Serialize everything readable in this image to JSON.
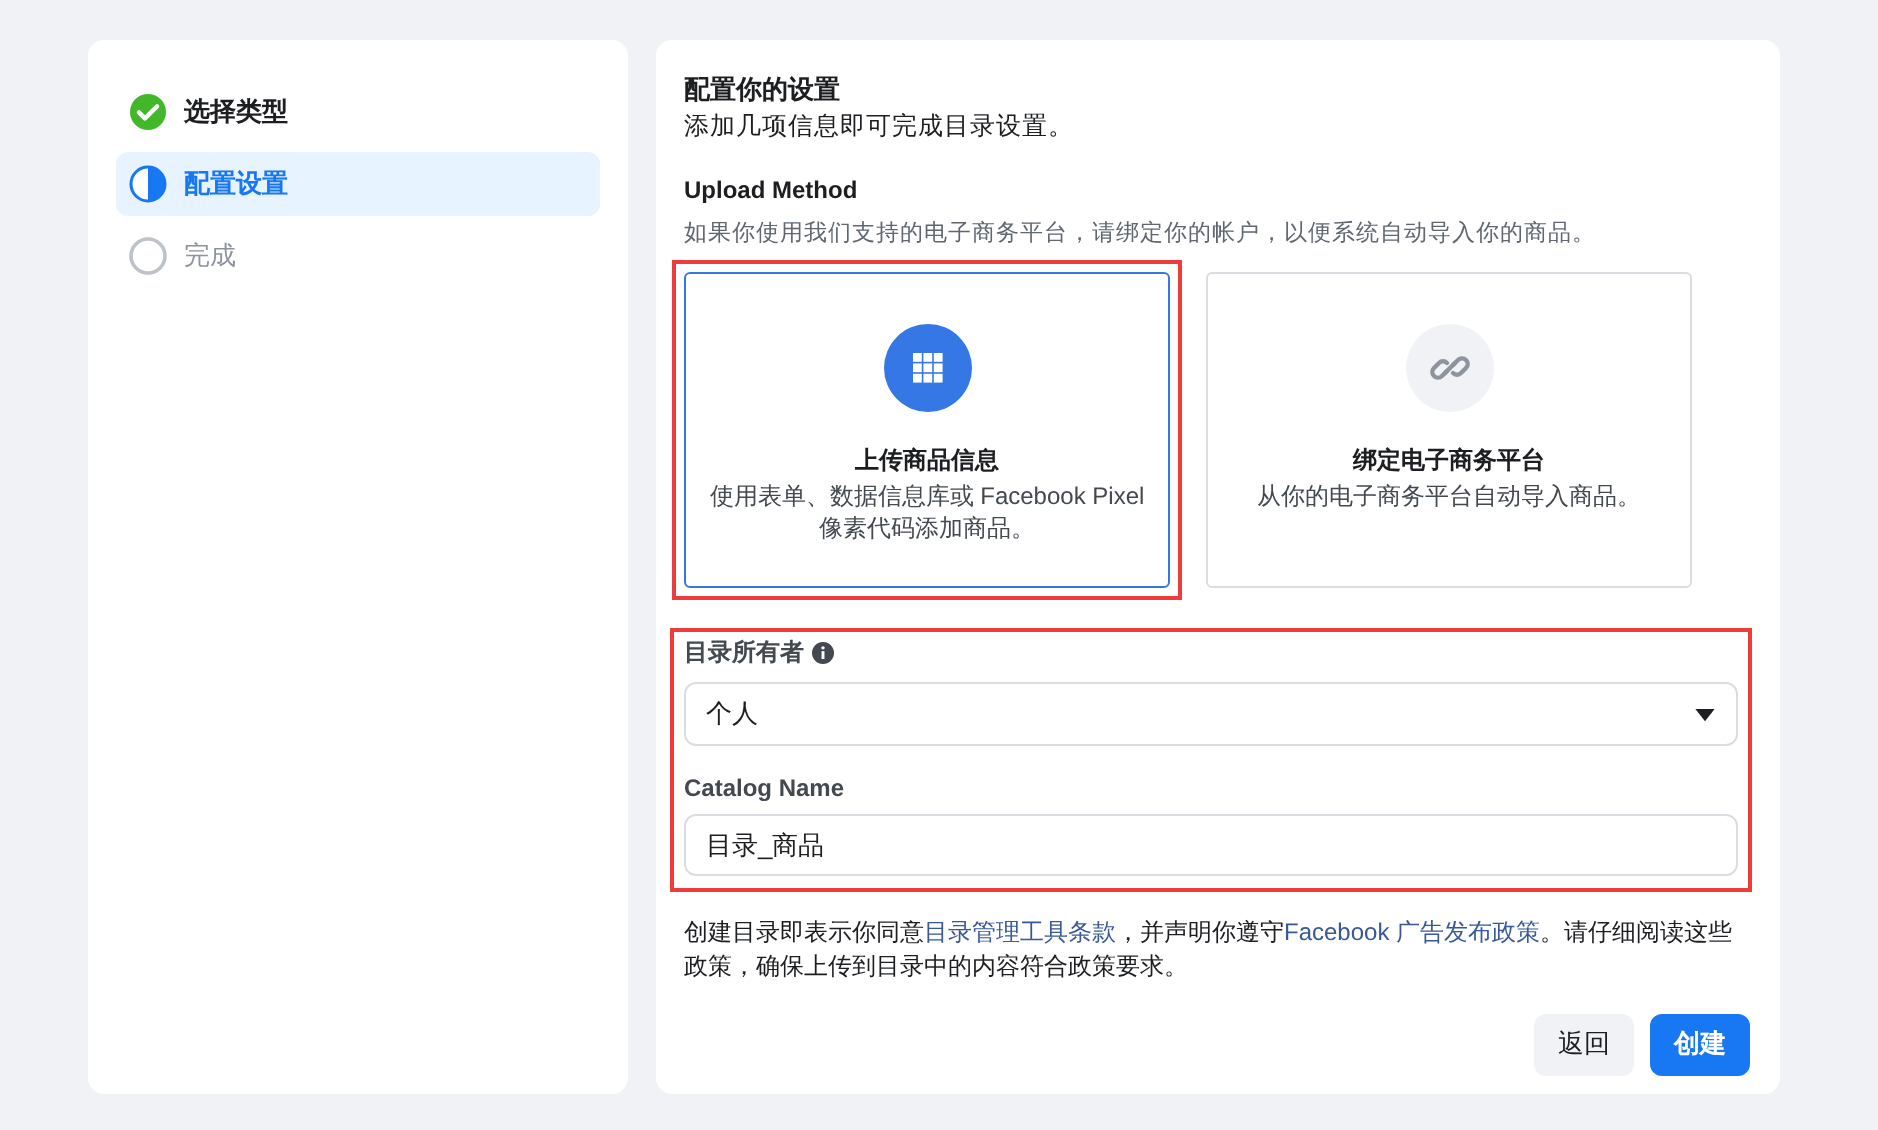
{
  "steps": [
    {
      "label": "选择类型",
      "kind": "done",
      "selected": false
    },
    {
      "label": "配置设置",
      "kind": "current",
      "selected": true
    },
    {
      "label": "完成",
      "kind": "todo",
      "selected": false
    }
  ],
  "settings": {
    "title": "配置你的设置",
    "subtitle": "添加几项信息即可完成目录设置。",
    "upload_method": {
      "label": "Upload Method",
      "hint": "如果你使用我们支持的电子商务平台，请绑定你的帐户，以便系统自动导入你的商品。",
      "options": [
        {
          "kind": "grid",
          "title": "上传商品信息",
          "description": "使用表单、数据信息库或 Facebook Pixel 像素代码添加商品。",
          "selected": true,
          "highlighted": true
        },
        {
          "kind": "link",
          "title": "绑定电子商务平台",
          "description": "从你的电子商务平台自动导入商品。",
          "selected": false,
          "highlighted": false
        }
      ]
    },
    "fields_highlighted": true,
    "owner": {
      "label": "目录所有者",
      "value": "个人"
    },
    "catalog_name": {
      "label": "Catalog Name",
      "value": "目录_商品"
    },
    "terms": [
      {
        "kind": "text",
        "text": "创建目录即表示你同意"
      },
      {
        "kind": "link",
        "text": "目录管理工具条款"
      },
      {
        "kind": "text",
        "text": "，并声明你遵守"
      },
      {
        "kind": "link",
        "text": "Facebook 广告发布政策"
      },
      {
        "kind": "text",
        "text": "。请仔细阅读这些政策，确保上传到目录中的内容符合政策要求。"
      }
    ],
    "buttons": [
      {
        "label": "返回",
        "kind": "secondary"
      },
      {
        "label": "创建",
        "kind": "primary"
      }
    ]
  }
}
